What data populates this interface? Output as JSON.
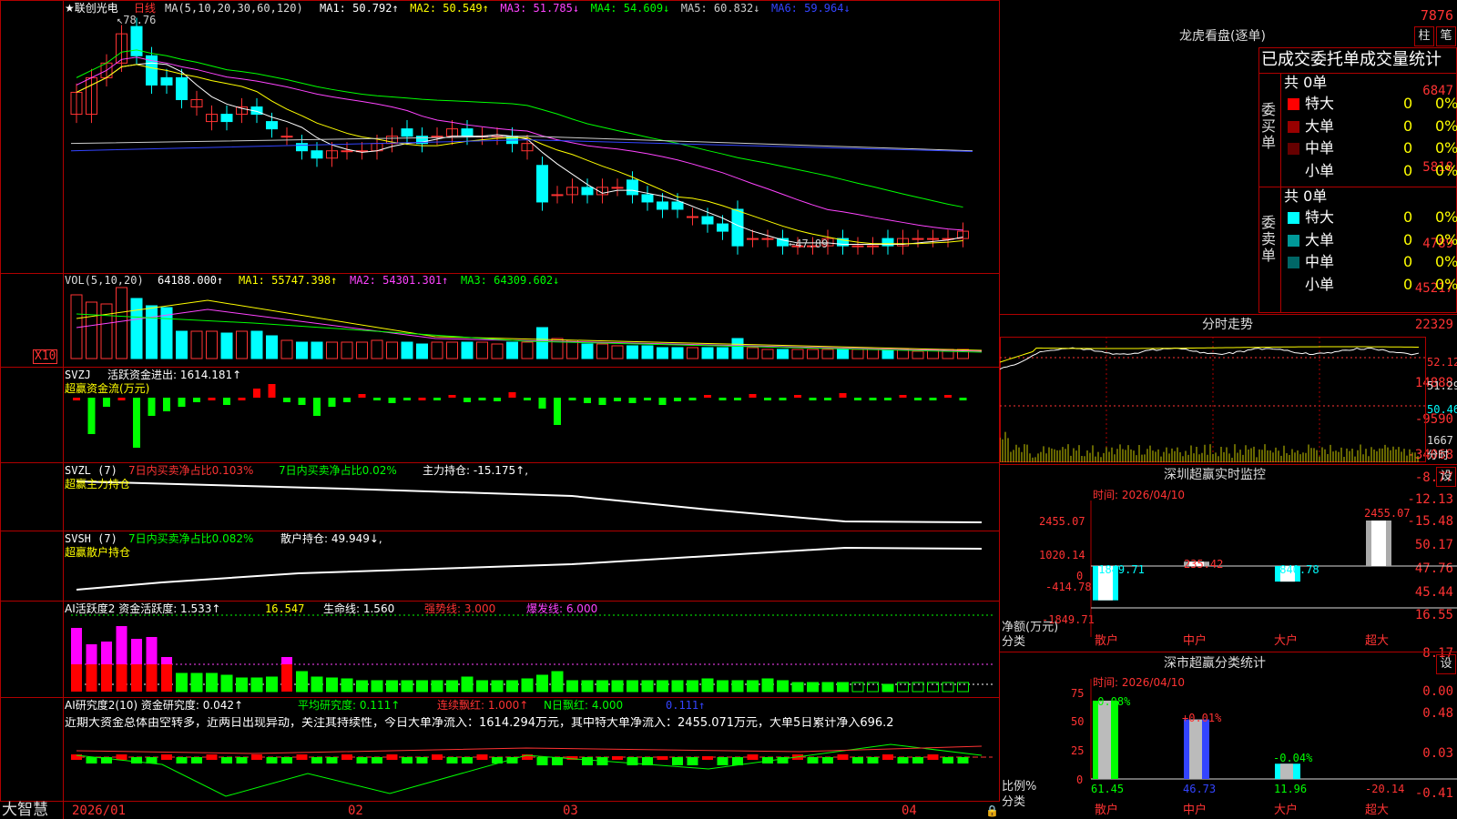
{
  "stock": {
    "name": "★联创光电",
    "period": "日线"
  },
  "price_panel": {
    "ma_label": "MA(5,10,20,30,60,120)",
    "ma": [
      {
        "t": "MA1: 50.792↑",
        "c": "#ffffff"
      },
      {
        "t": "MA2: 50.549↑",
        "c": "#ffff00"
      },
      {
        "t": "MA3: 51.785↓",
        "c": "#ff44ff"
      },
      {
        "t": "MA4: 54.609↓",
        "c": "#00ff00"
      },
      {
        "t": "MA5: 60.832↓",
        "c": "#cccccc"
      },
      {
        "t": "MA6: 59.964↓",
        "c": "#3344ff"
      }
    ],
    "y": [
      "78.76",
      "6847",
      "5818",
      "4789"
    ],
    "ytop": "7876",
    "high": "78.76",
    "low": "47.89"
  },
  "vol_panel": {
    "label": "VOL(5,10,20)",
    "v": "64188.000↑",
    "ma": [
      {
        "t": "MA1: 55747.398↑",
        "c": "#ffff00"
      },
      {
        "t": "MA2: 54301.301↑",
        "c": "#ff44ff"
      },
      {
        "t": "MA3: 64309.602↓",
        "c": "#00ff00"
      }
    ],
    "y": [
      "45217",
      "22329"
    ],
    "unit": "X10"
  },
  "svzj": {
    "label": "SVZJ",
    "t1": "活跃资金进出: 1614.181↑",
    "t2": "超赢资金流(万元)",
    "y": [
      "14888",
      "-9590",
      "-34068"
    ]
  },
  "svzl": {
    "label": "SVZL (7)",
    "t1": "7日内买卖净占比0.103%",
    "t2": "7日内买卖净占比0.02%",
    "t3": "主力持仓: -15.175↑,",
    "t4": "超赢主力持仓",
    "y": [
      "-8.77",
      "-12.13",
      "-15.48"
    ]
  },
  "svsh": {
    "label": "SVSH (7)",
    "t1": "7日内买卖净占比0.082%",
    "t2": "散户持仓: 49.949↓,",
    "t3": "超赢散户持仓",
    "y": [
      "50.17",
      "47.76",
      "45.44"
    ]
  },
  "ai1": {
    "t1": "AI活跃度2 资金活跃度: 1.533↑",
    "t2": "16.547",
    "t3": "生命线: 1.560",
    "t4": "强势线: 3.000",
    "t5": "爆发线: 6.000",
    "y": [
      "16.55",
      "8.17",
      "0.00"
    ]
  },
  "ai2": {
    "t1": "AI研究度2(10) 资金研究度: 0.042↑",
    "t2": "平均研究度: 0.111↑",
    "t3": "连续飘红: 1.000↑",
    "t4": "N日飘红: 4.000",
    "t5": "0.111↑",
    "note": "近期大资金总体由空转多，近两日出现异动，关注其持续性，今日大单净流入：1614.294万元，其中特大单净流入：2455.071万元，大单5日累计净入696.2",
    "y": [
      "0.48",
      "0.03",
      "-0.41"
    ]
  },
  "xaxis": [
    "2026/01",
    "02",
    "03",
    "04"
  ],
  "brand": "大智慧",
  "right": {
    "title": "龙虎看盘(逐单)",
    "btn1": "柱",
    "btn2": "笔",
    "stat_title": "已成交委托单成交量统计",
    "buy_label": "委买单",
    "sell_label": "委卖单",
    "buy_total": "共 0单",
    "sell_total": "共 0单",
    "buy_rows": [
      {
        "n": "特大",
        "c": "#ff0000",
        "v": "0",
        "p": "0%"
      },
      {
        "n": "大单",
        "c": "#990000",
        "v": "0",
        "p": "0%"
      },
      {
        "n": "中单",
        "c": "#660000",
        "v": "0",
        "p": "0%"
      },
      {
        "n": "小单",
        "c": "",
        "v": "0",
        "p": "0%"
      }
    ],
    "sell_rows": [
      {
        "n": "特大",
        "c": "#00ffff",
        "v": "0",
        "p": "0%"
      },
      {
        "n": "大单",
        "c": "#009999",
        "v": "0",
        "p": "0%"
      },
      {
        "n": "中单",
        "c": "#006666",
        "v": "0",
        "p": "0%"
      },
      {
        "n": "小单",
        "c": "",
        "v": "0",
        "p": "0%"
      }
    ],
    "intraday_title": "分时走势",
    "intraday_y": [
      "52.12",
      "51.29",
      "50.46"
    ],
    "intraday_vol": "1667",
    "intraday_unit": "分时",
    "sz_title": "深圳超赢实时监控",
    "sz_time": "时间: 2026/04/10",
    "sz_btn": "设",
    "sz_y": [
      "2455.07",
      "1020.14",
      "0",
      "-414.78",
      "-1849.71"
    ],
    "sz_vals": [
      "-1849.71",
      "235.42",
      "-840.78",
      "2455.07"
    ],
    "sz_axis": "净额(万元)",
    "sz_axis2": "分类",
    "cats": [
      "散户",
      "中户",
      "大户",
      "超大"
    ],
    "cls_title": "深市超赢分类统计",
    "cls_time": "时间: 2026/04/10",
    "cls_btn": "设",
    "cls_y": [
      "75",
      "50",
      "25",
      "0"
    ],
    "cls_pct": [
      "-0.08%",
      "+0.01%",
      "-0.04%"
    ],
    "cls_vals": [
      "61.45",
      "46.73",
      "11.96",
      "-20.14"
    ],
    "cls_axis": "比例%",
    "cls_axis2": "分类"
  }
}
